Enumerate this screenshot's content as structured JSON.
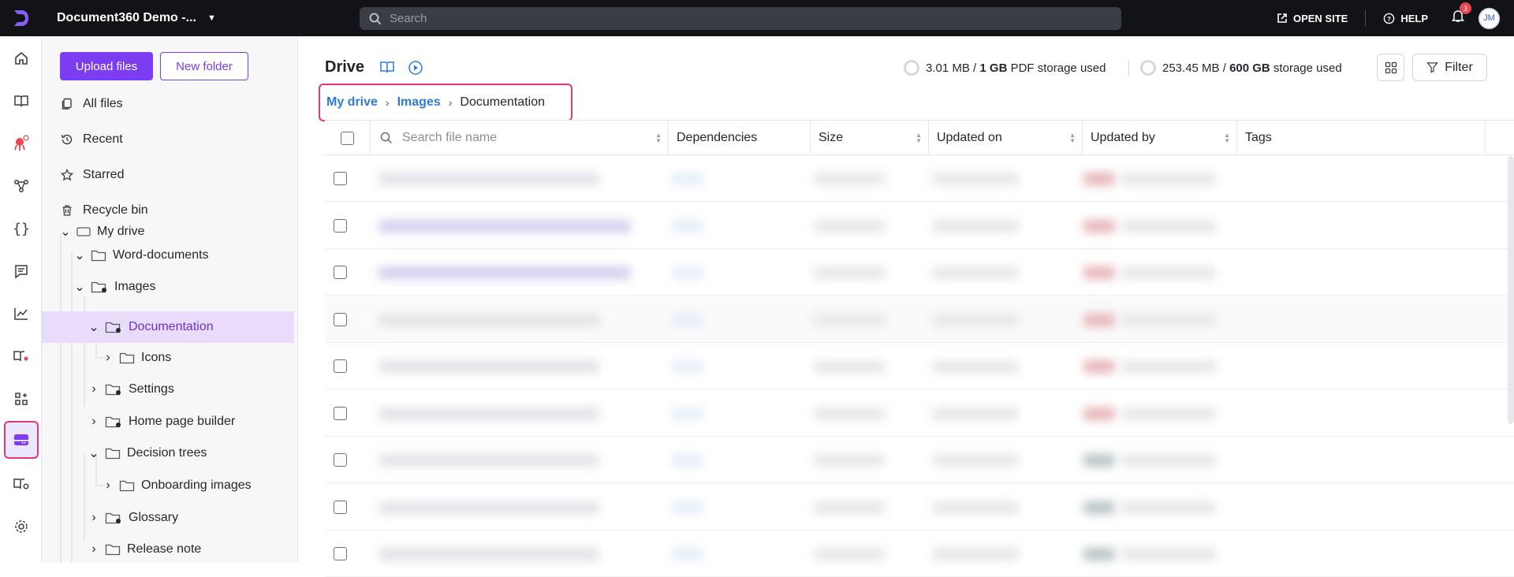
{
  "topbar": {
    "project_name": "Document360 Demo -...",
    "search_placeholder": "Search",
    "open_site": "OPEN SITE",
    "help": "HELP",
    "notifications_count": "3",
    "avatar_initials": "JM"
  },
  "sidepanel": {
    "upload_label": "Upload files",
    "new_folder_label": "New folder",
    "nav": [
      {
        "label": "All files",
        "icon": "files-icon"
      },
      {
        "label": "Recent",
        "icon": "history-icon"
      },
      {
        "label": "Starred",
        "icon": "star-icon"
      },
      {
        "label": "Recycle bin",
        "icon": "trash-icon"
      }
    ],
    "tree": [
      {
        "label": "My drive",
        "expanded": true
      },
      {
        "label": "Word-documents",
        "expanded": true
      },
      {
        "label": "Images",
        "expanded": true
      },
      {
        "label": "Documentation",
        "expanded": true,
        "selected": true
      },
      {
        "label": "Icons",
        "expanded": false
      },
      {
        "label": "Settings",
        "expanded": false
      },
      {
        "label": "Home page builder",
        "expanded": false
      },
      {
        "label": "Decision trees",
        "expanded": true
      },
      {
        "label": "Onboarding images",
        "expanded": false
      },
      {
        "label": "Glossary",
        "expanded": false
      },
      {
        "label": "Release note",
        "expanded": false
      }
    ]
  },
  "main": {
    "title": "Drive",
    "pdf_storage": {
      "used": "3.01 MB",
      "sep": " / ",
      "total": "1 GB",
      "suffix": " PDF storage used"
    },
    "storage": {
      "used": "253.45 MB",
      "sep": " / ",
      "total": "600 GB",
      "suffix": " storage used"
    },
    "filter_label": "Filter",
    "breadcrumb": {
      "root": "My drive",
      "parent": "Images",
      "current": "Documentation"
    },
    "table": {
      "search_placeholder": "Search file name",
      "columns": [
        "Dependencies",
        "Size",
        "Updated on",
        "Updated by",
        "Tags"
      ],
      "row_count": 9
    }
  },
  "colors": {
    "accent": "#7b3cf2",
    "highlight_border": "#e03a76",
    "link": "#2e7bd6",
    "topbar_bg": "#121317"
  }
}
